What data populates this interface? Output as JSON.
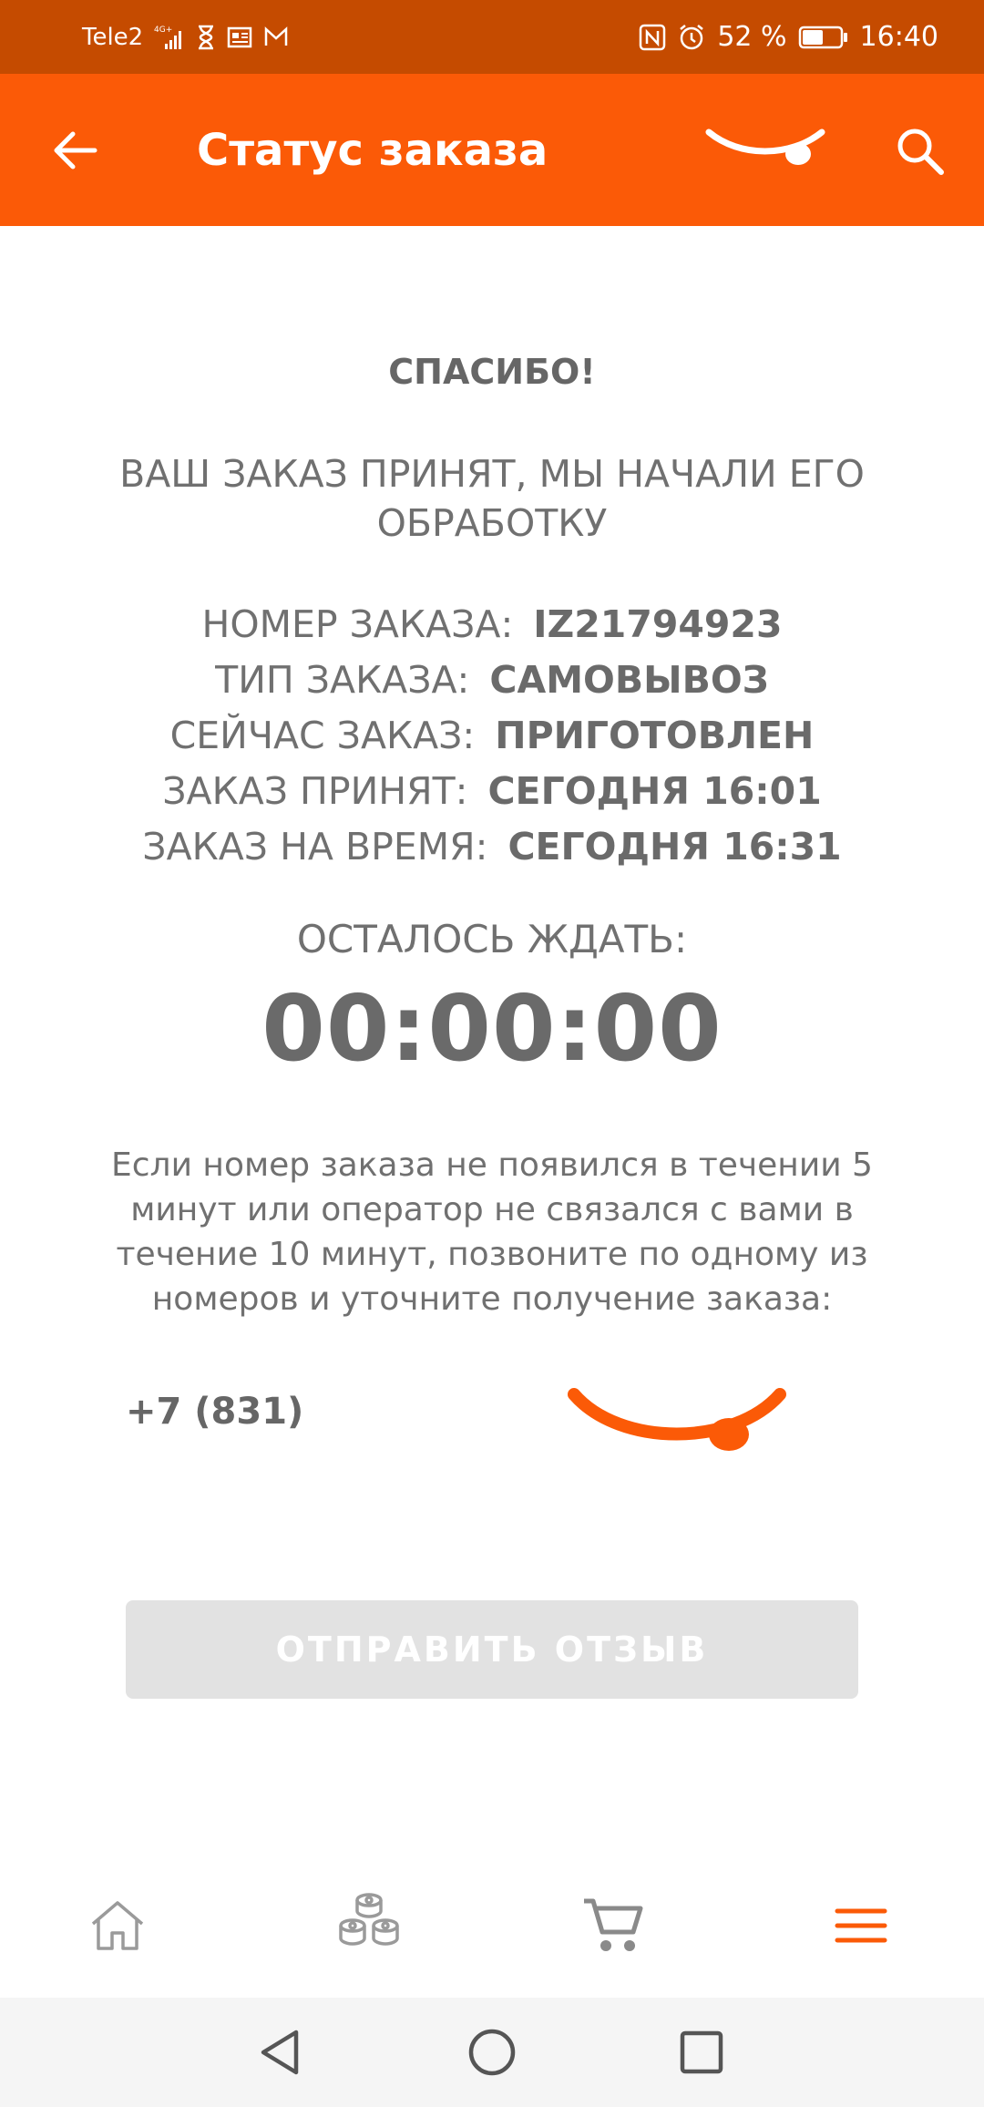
{
  "status_bar": {
    "carrier": "Tele2",
    "network": "4G+",
    "battery": "52 %",
    "time": "16:40",
    "icons": [
      "signal-icon",
      "hourglass-icon",
      "news-icon",
      "mail-icon",
      "nfc-icon",
      "alarm-icon",
      "battery-icon"
    ]
  },
  "app_bar": {
    "title": "Статус заказа",
    "back_icon": "arrow-left-icon",
    "logo_icon": "smile-logo-icon",
    "search_icon": "search-icon"
  },
  "order": {
    "thanks": "СПАСИБО!",
    "accepted": "ВАШ ЗАКАЗ ПРИНЯТ, МЫ НАЧАЛИ ЕГО ОБРАБОТКУ",
    "rows": [
      {
        "label": "НОМЕР ЗАКАЗА:",
        "value": "IZ21794923"
      },
      {
        "label": "ТИП ЗАКАЗА:",
        "value": "САМОВЫВОЗ"
      },
      {
        "label": "СЕЙЧАС ЗАКАЗ:",
        "value": "ПРИГОТОВЛЕН"
      },
      {
        "label": "ЗАКАЗ ПРИНЯТ:",
        "value": "СЕГОДНЯ 16:01"
      },
      {
        "label": "ЗАКАЗ НА ВРЕМЯ:",
        "value": "СЕГОДНЯ 16:31"
      }
    ],
    "remaining_label": "ОСТАЛОСЬ ЖДАТЬ:",
    "timer": "00:00:00",
    "note": "Если номер заказа не появился в течении 5 минут или оператор не связался с вами в течение 10 минут, позвоните по одному из номеров и уточните получение заказа:",
    "phone": "+7 (831)",
    "review_button": "ОТПРАВИТЬ ОТЗЫВ"
  },
  "colors": {
    "status_bar": "#c54b00",
    "app_bar": "#fb5a07",
    "accent": "#fb5a07",
    "text": "#707070",
    "button_disabled": "#e2e2e2"
  },
  "bottom_nav": {
    "items": [
      {
        "icon": "home-icon"
      },
      {
        "icon": "sushi-menu-icon"
      },
      {
        "icon": "cart-icon"
      },
      {
        "icon": "hamburger-menu-icon"
      }
    ]
  },
  "system_nav": {
    "items": [
      {
        "icon": "back-triangle-icon"
      },
      {
        "icon": "home-circle-icon"
      },
      {
        "icon": "recents-square-icon"
      }
    ]
  }
}
